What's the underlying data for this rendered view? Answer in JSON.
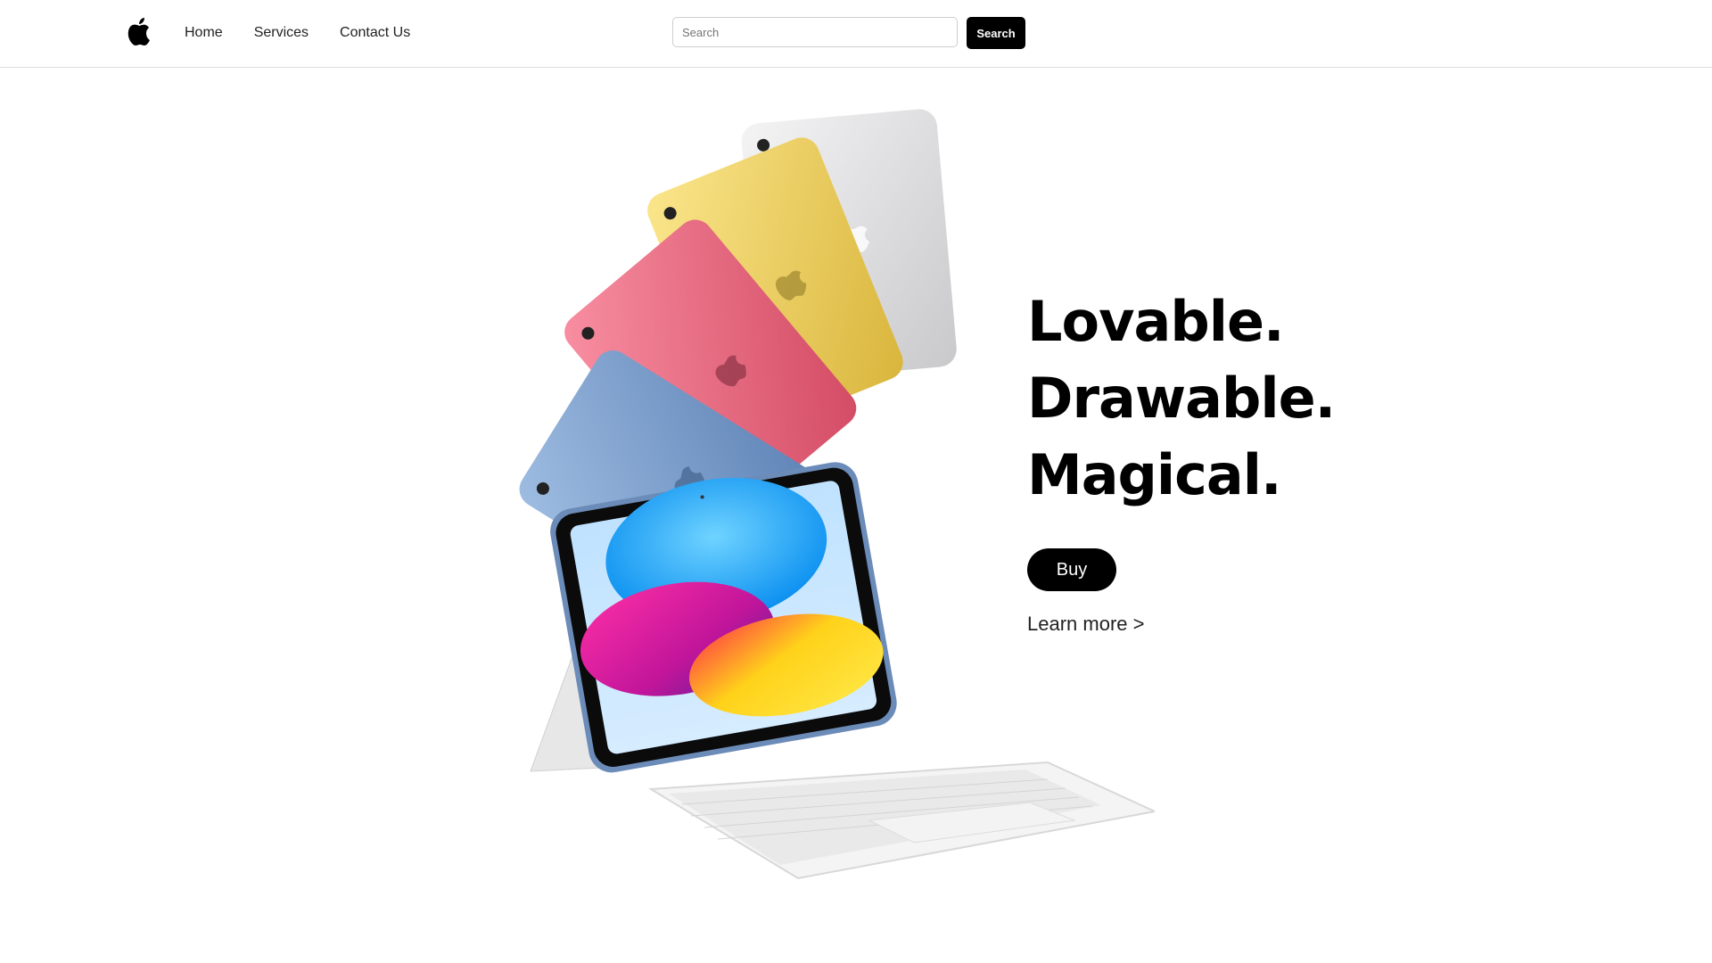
{
  "nav": {
    "logo_icon": "apple-logo-icon",
    "links": [
      "Home",
      "Services",
      "Contact Us"
    ]
  },
  "search": {
    "placeholder": "Search",
    "button_label": "Search"
  },
  "hero": {
    "headline": [
      "Lovable.",
      "Drawable.",
      "Magical."
    ],
    "buy_label": "Buy",
    "learn_more_label": "Learn more >",
    "product_colors": {
      "silver": "#e6e6e8",
      "yellow": "#f2d35a",
      "pink": "#ef6f86",
      "blue": "#7fa3cf",
      "keyboard": "#f1f1f1"
    }
  }
}
